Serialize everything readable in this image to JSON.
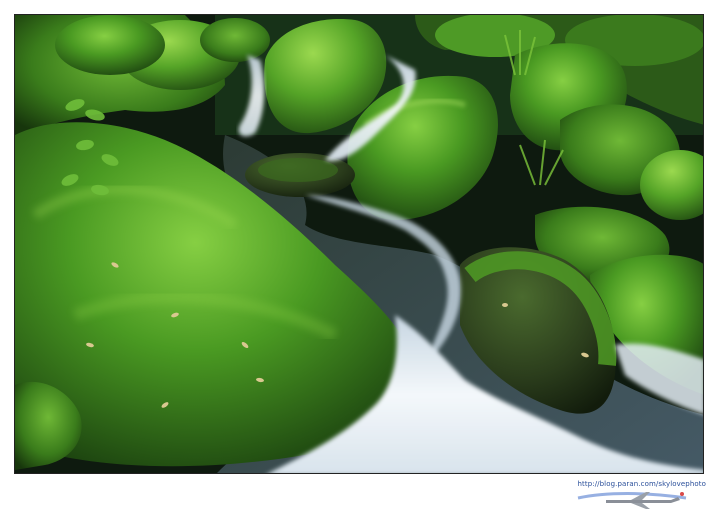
{
  "image": {
    "subject": "mossy-stream",
    "colors": {
      "moss": "#3f8f1c",
      "moss_highlight": "#7cc43a",
      "moss_shadow": "#1f4a10",
      "water": "#e8f0f6",
      "water_shadow": "#7d93a8",
      "dark": "#0d1a0e"
    }
  },
  "watermark": {
    "url": "http://blog.paran.com/skylovephoto",
    "logo_icon": "airplane-logo-icon"
  }
}
